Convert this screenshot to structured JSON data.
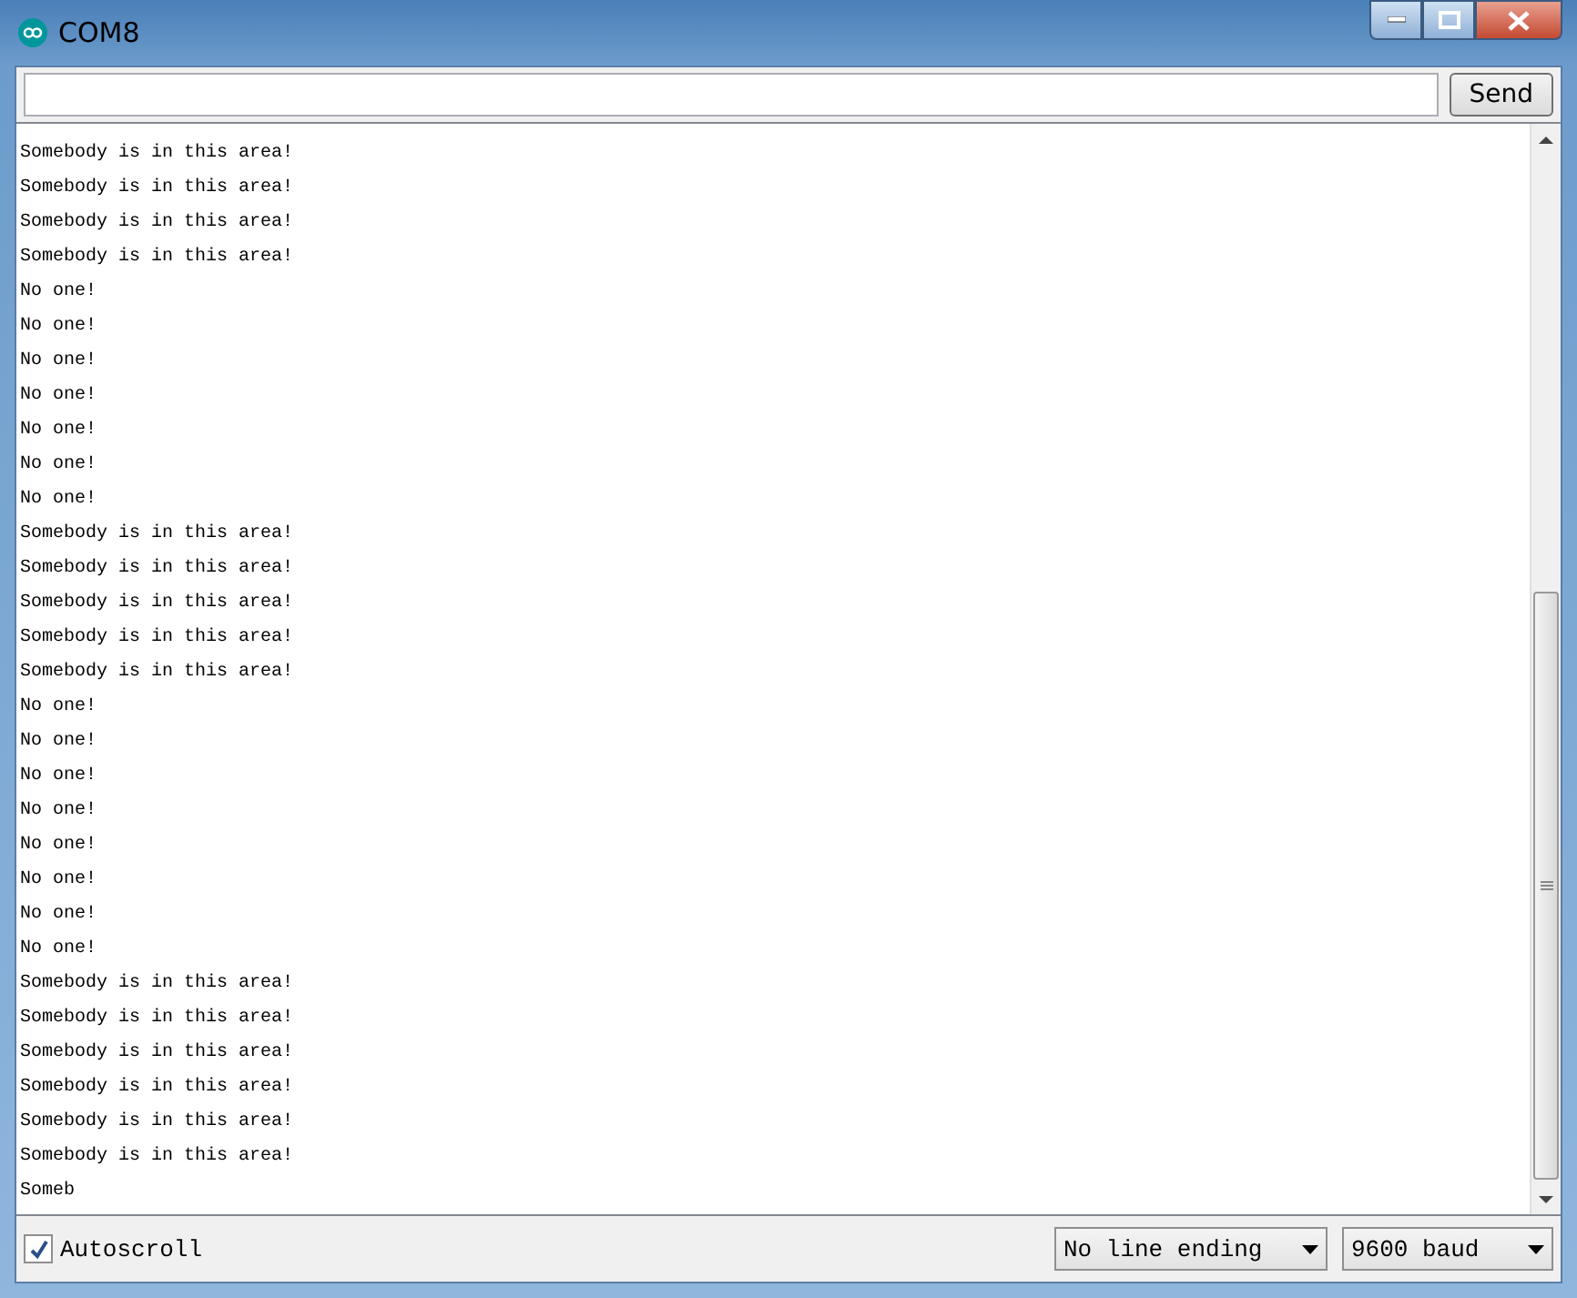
{
  "window": {
    "title": "COM8"
  },
  "send_button": {
    "label": "Send"
  },
  "output": {
    "lines": [
      "Somebody is in this area!",
      "Somebody is in this area!",
      "Somebody is in this area!",
      "Somebody is in this area!",
      "No one!",
      "No one!",
      "No one!",
      "No one!",
      "No one!",
      "No one!",
      "No one!",
      "Somebody is in this area!",
      "Somebody is in this area!",
      "Somebody is in this area!",
      "Somebody is in this area!",
      "Somebody is in this area!",
      "No one!",
      "No one!",
      "No one!",
      "No one!",
      "No one!",
      "No one!",
      "No one!",
      "No one!",
      "Somebody is in this area!",
      "Somebody is in this area!",
      "Somebody is in this area!",
      "Somebody is in this area!",
      "Somebody is in this area!",
      "Somebody is in this area!",
      "Someb"
    ]
  },
  "autoscroll": {
    "label": "Autoscroll",
    "checked": true
  },
  "line_ending": {
    "value": "No line ending"
  },
  "baud_rate": {
    "value": "9600 baud"
  }
}
